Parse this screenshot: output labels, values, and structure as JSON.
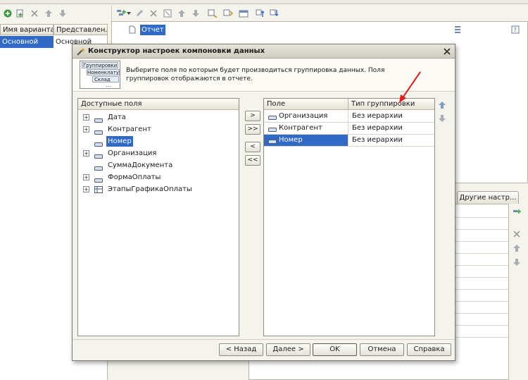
{
  "variants_panel": {
    "col_name": "Имя варианта",
    "col_repr": "Представлен...",
    "row_name": "Основной",
    "row_repr": "Основной"
  },
  "report_tree": {
    "root_label": "Отчет"
  },
  "other_settings_tab": "Другие настр...",
  "dialog": {
    "title": "Конструктор настроек компоновки данных",
    "hint": "Выберите поля по которым будет производиться группировка данных. Поля группировок отображаются в отчете.",
    "illustration_labels": [
      "Группировки",
      "Номенклатура",
      "Склад",
      "..."
    ],
    "available_header": "Доступные поля",
    "available_fields": [
      {
        "label": "Дата",
        "expandable": true,
        "icon": "field-icon",
        "selected": false
      },
      {
        "label": "Контрагент",
        "expandable": true,
        "icon": "field-icon",
        "selected": false
      },
      {
        "label": "Номер",
        "expandable": false,
        "icon": "field-icon",
        "selected": true
      },
      {
        "label": "Организация",
        "expandable": true,
        "icon": "field-icon",
        "selected": false
      },
      {
        "label": "СуммаДокумента",
        "expandable": false,
        "icon": "field-icon",
        "selected": false
      },
      {
        "label": "ФормаОплаты",
        "expandable": true,
        "icon": "field-icon",
        "selected": false
      },
      {
        "label": "ЭтапыГрафикаОплаты",
        "expandable": true,
        "icon": "table-icon",
        "selected": false
      }
    ],
    "move_buttons": [
      ">",
      ">>",
      "<",
      "<<"
    ],
    "grouping_headers": {
      "field": "Поле",
      "type": "Тип группировки"
    },
    "grouping_rows": [
      {
        "field": "Организация",
        "type": "Без иерархии",
        "selected": false
      },
      {
        "field": "Контрагент",
        "type": "Без иерархии",
        "selected": false
      },
      {
        "field": "Номер",
        "type": "Без иерархии",
        "selected": true
      }
    ],
    "buttons": {
      "back": "< Назад",
      "next": "Далее >",
      "ok": "OK",
      "cancel": "Отмена",
      "help": "Справка"
    }
  },
  "colors": {
    "selection": "#3169c6",
    "annotation_arrow": "#e21c1c",
    "title_bar": "#d6d3c7"
  }
}
